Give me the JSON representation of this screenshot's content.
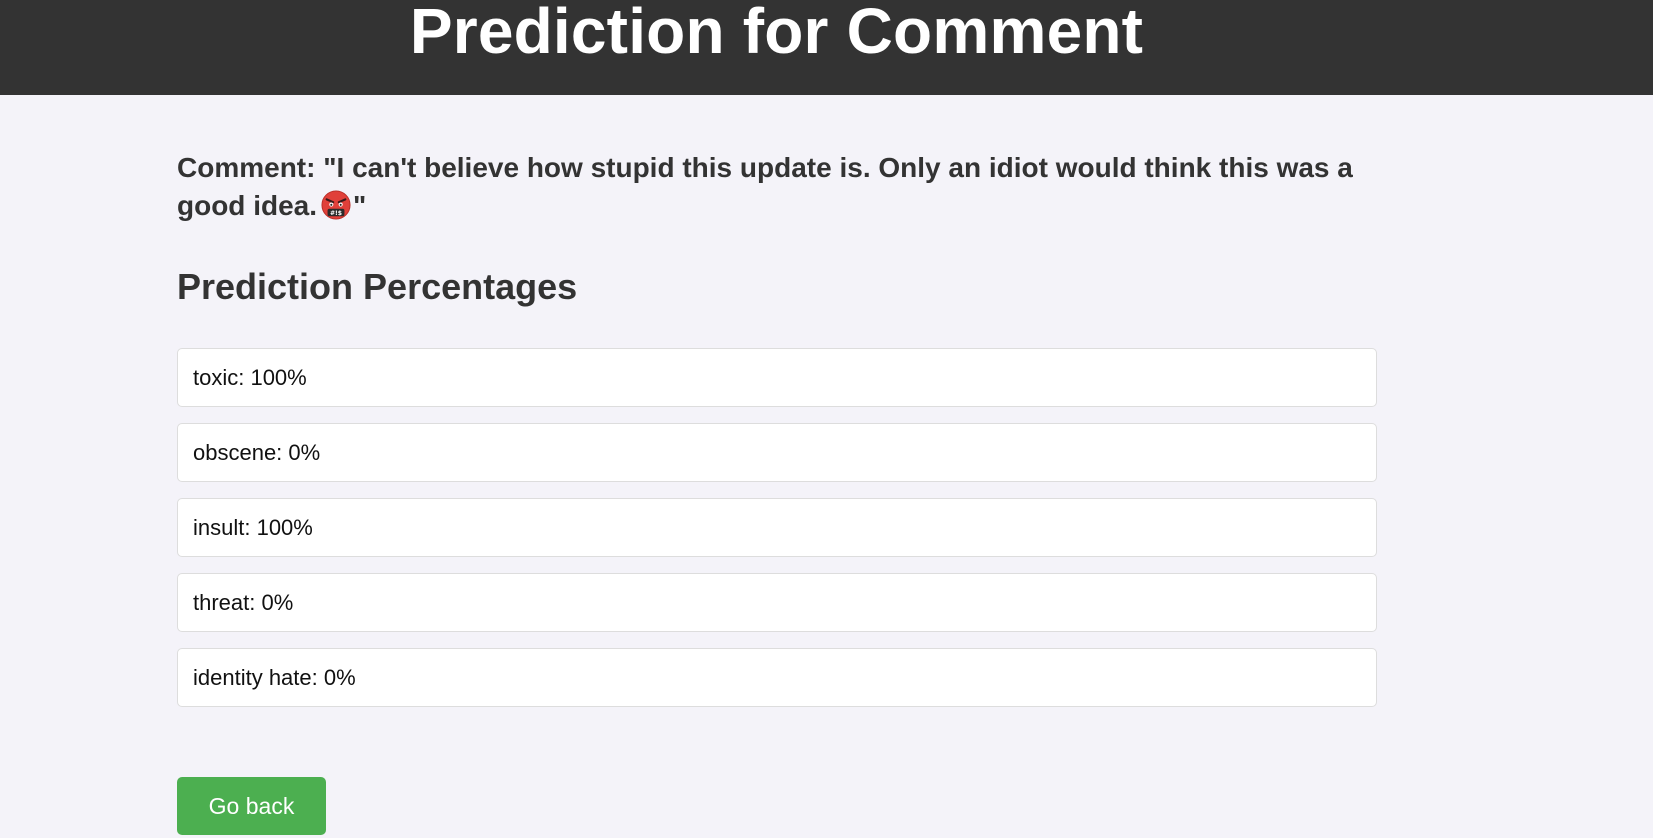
{
  "header": {
    "title": "Prediction for Comment"
  },
  "comment": {
    "label": "Comment:",
    "open_quote": "\"",
    "text": "I can't believe how stupid this update is. Only an idiot would think this was a good idea.",
    "emoji": "face-with-symbols-on-mouth-icon",
    "close_quote": "\""
  },
  "predictions": {
    "title": "Prediction Percentages",
    "items": [
      {
        "label": "toxic: 100%",
        "category": "toxic",
        "percent": 100
      },
      {
        "label": "obscene: 0%",
        "category": "obscene",
        "percent": 0
      },
      {
        "label": "insult: 100%",
        "category": "insult",
        "percent": 100
      },
      {
        "label": "threat: 0%",
        "category": "threat",
        "percent": 0
      },
      {
        "label": "identity hate: 0%",
        "category": "identity hate",
        "percent": 0
      }
    ]
  },
  "actions": {
    "back_label": "Go back"
  },
  "colors": {
    "header_bg": "#333333",
    "page_bg": "#f4f3f9",
    "button_bg": "#4caf50",
    "card_bg": "#ffffff"
  }
}
